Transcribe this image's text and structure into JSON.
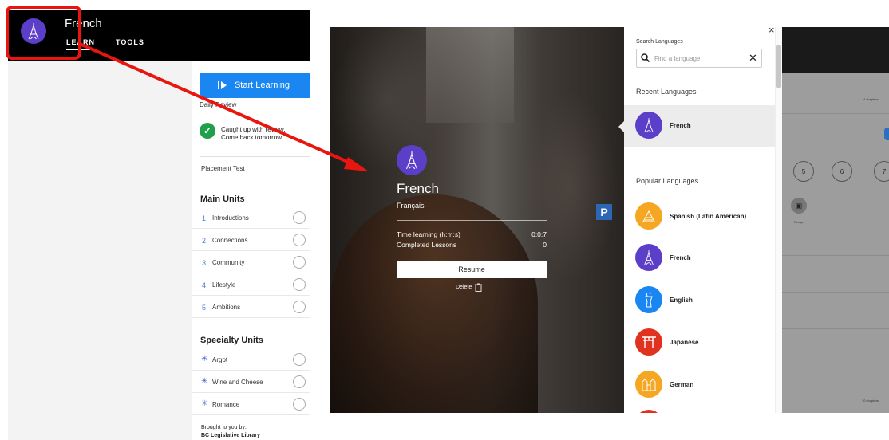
{
  "left": {
    "course_title": "French",
    "tabs": [
      "LEARN",
      "TOOLS"
    ],
    "start_button": "Start Learning",
    "daily_review": {
      "label": "Daily Review",
      "line1": "Caught up with review.",
      "line2": "Come back tomorrow."
    },
    "placement_test": "Placement Test",
    "main_units_title": "Main Units",
    "main_units": [
      {
        "num": "1",
        "name": "Introductions"
      },
      {
        "num": "2",
        "name": "Connections"
      },
      {
        "num": "3",
        "name": "Community"
      },
      {
        "num": "4",
        "name": "Lifestyle"
      },
      {
        "num": "5",
        "name": "Ambitions"
      }
    ],
    "specialty_title": "Specialty Units",
    "specialty_units": [
      "Argot",
      "Wine and Cheese",
      "Romance"
    ],
    "brought_by": "Brought to you by:",
    "library": "BC Legislative Library"
  },
  "detail": {
    "language": "French",
    "native_name": "Français",
    "time_label": "Time learning (h:m:s)",
    "time_value": "0:0:7",
    "completed_label": "Completed Lessons",
    "completed_value": "0",
    "resume": "Resume",
    "delete": "Delete",
    "sign_letter": "P"
  },
  "picker": {
    "close": "×",
    "search_label": "Search Languages",
    "search_placeholder": "Find a language.",
    "clear": "✕",
    "recent_heading": "Recent Languages",
    "recent": [
      {
        "name": "French",
        "color": "#5b3fc8"
      }
    ],
    "popular_heading": "Popular Languages",
    "popular": [
      {
        "name": "Spanish (Latin American)",
        "color": "#f5a623"
      },
      {
        "name": "French",
        "color": "#5b3fc8"
      },
      {
        "name": "English",
        "color": "#1a86f2"
      },
      {
        "name": "Japanese",
        "color": "#e0321f"
      },
      {
        "name": "German",
        "color": "#f5a623"
      }
    ]
  },
  "right": {
    "chapters_top": "4 chapters",
    "chapters_bottom": "10 chapters",
    "chapter_numbers": [
      "5",
      "6",
      "7"
    ],
    "recap": "Recap"
  },
  "colors": {
    "accent_blue": "#1a86f2",
    "french_purple": "#5b3fc8",
    "highlight_red": "#e8160e",
    "success_green": "#1f9e4b"
  }
}
